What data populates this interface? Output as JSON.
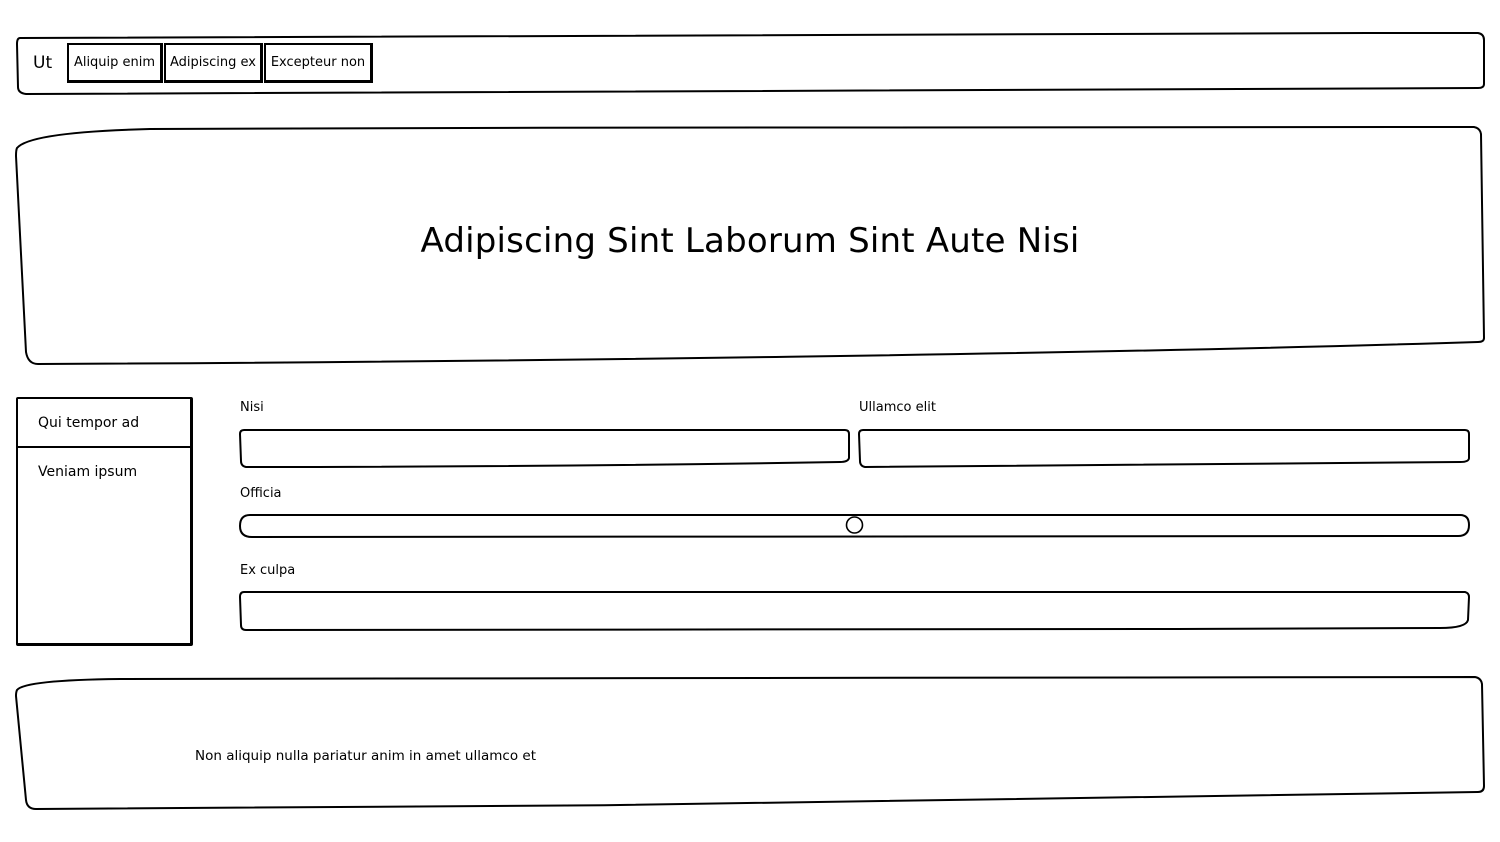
{
  "header": {
    "brand": "Ut",
    "nav": [
      {
        "label": "Aliquip enim"
      },
      {
        "label": "Adipiscing ex"
      },
      {
        "label": "Excepteur non"
      }
    ]
  },
  "hero": {
    "title": "Adipiscing Sint Laborum Sint Aute Nisi"
  },
  "sidebar": {
    "items": [
      {
        "label": "Qui tempor ad"
      },
      {
        "label": "Veniam ipsum"
      }
    ]
  },
  "form": {
    "field1": {
      "label": "Nisi",
      "value": ""
    },
    "field2": {
      "label": "Ullamco elit",
      "value": ""
    },
    "slider": {
      "label": "Officia",
      "value": 0.5
    },
    "field3": {
      "label": "Ex culpa",
      "value": ""
    }
  },
  "footer": {
    "text": "Non aliquip nulla pariatur anim in amet ullamco et"
  }
}
